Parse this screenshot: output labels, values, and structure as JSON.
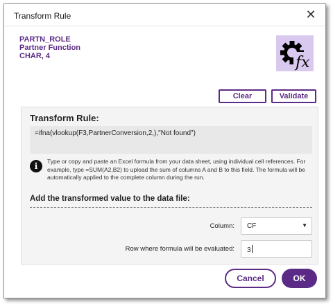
{
  "window": {
    "title": "Transform Rule",
    "close_glyph": "✕"
  },
  "field": {
    "name": "PARTN_ROLE",
    "description": "Partner Function",
    "type": "CHAR, 4"
  },
  "logo": {
    "icon": "gear-fx-icon",
    "text": "fx"
  },
  "toolbar": {
    "clear_label": "Clear",
    "validate_label": "Validate"
  },
  "rule": {
    "heading": "Transform Rule:",
    "formula": "=ifna(vlookup(F3,PartnerConversion,2,),\"Not found\")",
    "info_icon_glyph": "i",
    "help_text": "Type or copy and paste an Excel formula from your data sheet, using individual cell references. For example, type =SUM(A2,B2) to upload the sum of columns A and B to this field. The formula will be automatically applied to the complete column during the run."
  },
  "output": {
    "heading": "Add the transformed value to the data file:",
    "column_label": "Column:",
    "column_value": "CF",
    "row_label": "Row where formula will be evaluated:",
    "row_value": "3"
  },
  "footer": {
    "cancel_label": "Cancel",
    "ok_label": "OK"
  },
  "colors": {
    "accent": "#5b2a86",
    "logo_bg": "#d9c9ef",
    "panel_bg": "#f4f4f4",
    "formula_bg": "#e8e8e8"
  }
}
